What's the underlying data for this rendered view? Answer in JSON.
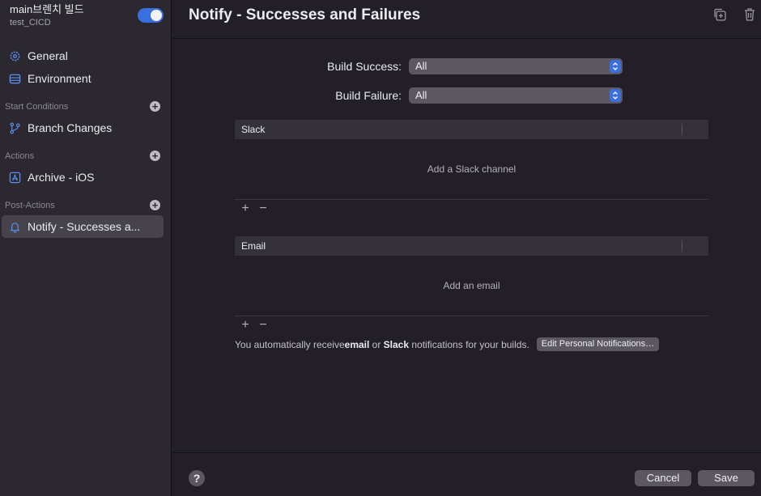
{
  "workflow": {
    "title": "main브렌치 빌드",
    "subtitle": "test_CICD",
    "enabled": true
  },
  "sidebar": {
    "general_label": "General",
    "environment_label": "Environment",
    "start_conditions_label": "Start Conditions",
    "branch_changes_label": "Branch Changes",
    "actions_label": "Actions",
    "archive_label": "Archive - iOS",
    "post_actions_label": "Post-Actions",
    "notify_label": "Notify - Successes a..."
  },
  "main": {
    "title": "Notify - Successes and Failures",
    "build_success_label": "Build Success:",
    "build_success_value": "All",
    "build_failure_label": "Build Failure:",
    "build_failure_value": "All",
    "slack": {
      "header": "Slack",
      "empty_text": "Add a Slack channel"
    },
    "email": {
      "header": "Email",
      "empty_text": "Add an email"
    },
    "note": {
      "part1": "You automatically receive ",
      "email_word": "email",
      "part2": " or ",
      "slack_word": "Slack",
      "part3": " notifications for your builds.",
      "button_label": "Edit Personal Notifications…"
    }
  },
  "footer": {
    "help_label": "?",
    "cancel_label": "Cancel",
    "save_label": "Save"
  },
  "colors": {
    "accent": "#3a6fe0",
    "background": "#221f28",
    "sidebar": "#2b2830"
  }
}
